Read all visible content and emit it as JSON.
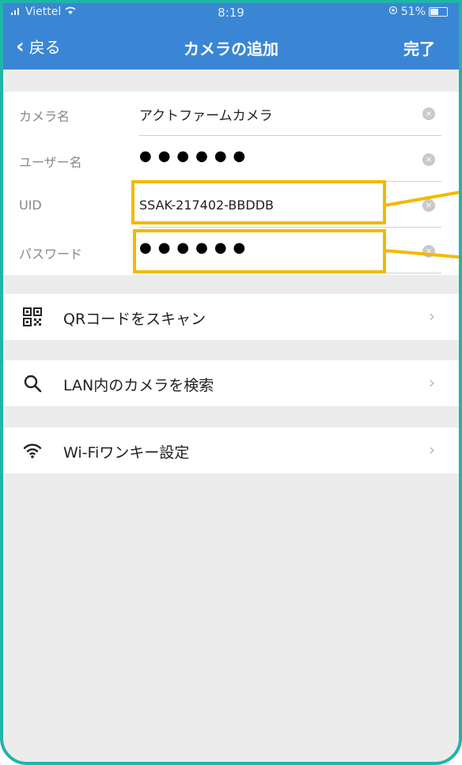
{
  "status_bar": {
    "carrier": "Viettel",
    "time": "8:19",
    "battery": "51%"
  },
  "nav": {
    "back_label": "戻る",
    "title": "カメラの追加",
    "done_label": "完了"
  },
  "form": {
    "camera_name_label": "カメラ名",
    "camera_name_value": "アクトファームカメラ",
    "username_label": "ユーザー名",
    "username_value": "●●●●●●",
    "uid_label": "UID",
    "uid_value": "SSAK-217402-BBDDB",
    "password_label": "パスワード",
    "password_value": "●●●●●●"
  },
  "actions": {
    "qr_label": "QRコードをスキャン",
    "lan_label": "LAN内のカメラを検索",
    "wifi_label": "Wi-Fiワンキー設定"
  },
  "colors": {
    "header": "#3a86d4",
    "highlight": "#f5b800",
    "frame": "#1fb5a8"
  }
}
